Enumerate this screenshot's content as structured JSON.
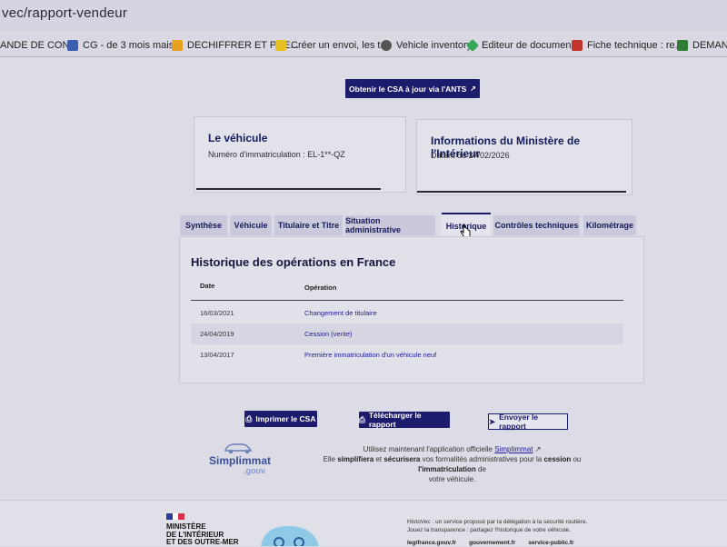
{
  "browser": {
    "url": "vec/rapport-vendeur",
    "bookmarks": [
      {
        "label": "ANDE DE CON...",
        "color": "#7a7a7a"
      },
      {
        "label": "CG - de 3 mois mais...",
        "color": "#3a5fb0"
      },
      {
        "label": "DECHIFFRER ET PRE...",
        "color": "#e8a020"
      },
      {
        "label": "Créer un envoi, les t...",
        "color": "#e8c020"
      },
      {
        "label": "Vehicle inventory",
        "color": "#555555"
      },
      {
        "label": "Editeur de documen...",
        "color": "#34a853"
      },
      {
        "label": "Fiche technique : re...",
        "color": "#c0342c"
      },
      {
        "label": "DEMANDE",
        "color": "#2e7d32"
      }
    ]
  },
  "top_button": {
    "label": "Obtenir le CSA à jour via l'ANTS"
  },
  "vehicle_card": {
    "title": "Le véhicule",
    "subtitle": "Numéro d'immatriculation : EL-1**-QZ"
  },
  "ministry_card": {
    "title": "Informations du Ministère de l'Intérieur",
    "subtitle": "Datant du 27/02/2026"
  },
  "tabs": [
    {
      "label": "Synthèse",
      "active": false
    },
    {
      "label": "Véhicule",
      "active": false
    },
    {
      "label": "Titulaire et Titre",
      "active": false
    },
    {
      "label": "Situation administrative",
      "active": false
    },
    {
      "label": "Historique",
      "active": true
    },
    {
      "label": "Contrôles techniques",
      "active": false
    },
    {
      "label": "Kilométrage",
      "active": false
    }
  ],
  "history": {
    "title": "Historique des opérations en France",
    "columns": [
      "Date",
      "Opération"
    ],
    "rows": [
      {
        "date": "16/03/2021",
        "operation": "Changement de titulaire"
      },
      {
        "date": "24/04/2019",
        "operation": "Cession (vente)"
      },
      {
        "date": "13/04/2017",
        "operation": "Première immatriculation d'un véhicule neuf"
      }
    ]
  },
  "actions": {
    "print": "Imprimer le CSA",
    "download": "Télécharger le rapport",
    "send": "Envoyer le rapport"
  },
  "promo": {
    "logo_text": "SimpIimmat",
    "logo_sub": ".gouv",
    "line1_prefix": "Utilisez maintenant l'application officielle",
    "line1_link": "SimpIimmat",
    "line2_a": "Elle",
    "line2_b": "simplifiera",
    "line2_c": "et",
    "line2_d": "sécurisera",
    "line2_e": "vos formalités administratives pour la",
    "line2_f": "cession",
    "line2_g": "ou",
    "line2_h": "l'immatriculation",
    "line2_i": "de",
    "line3": "votre véhicule."
  },
  "footer": {
    "ministry_lines": [
      "MINISTÈRE",
      "DE L'INTÉRIEUR",
      "ET DES OUTRE-MER"
    ],
    "desc1": "HistoVec : un service proposé par la délégation à la sécurité routière.",
    "desc2": "Jouez la transparence : partagez l'historique de votre véhicule.",
    "links": [
      "legifrance.gouv.fr",
      "gouvernement.fr",
      "service-public.fr"
    ]
  },
  "colors": {
    "primary": "#1d1b6b",
    "link": "#1d1b9b"
  }
}
